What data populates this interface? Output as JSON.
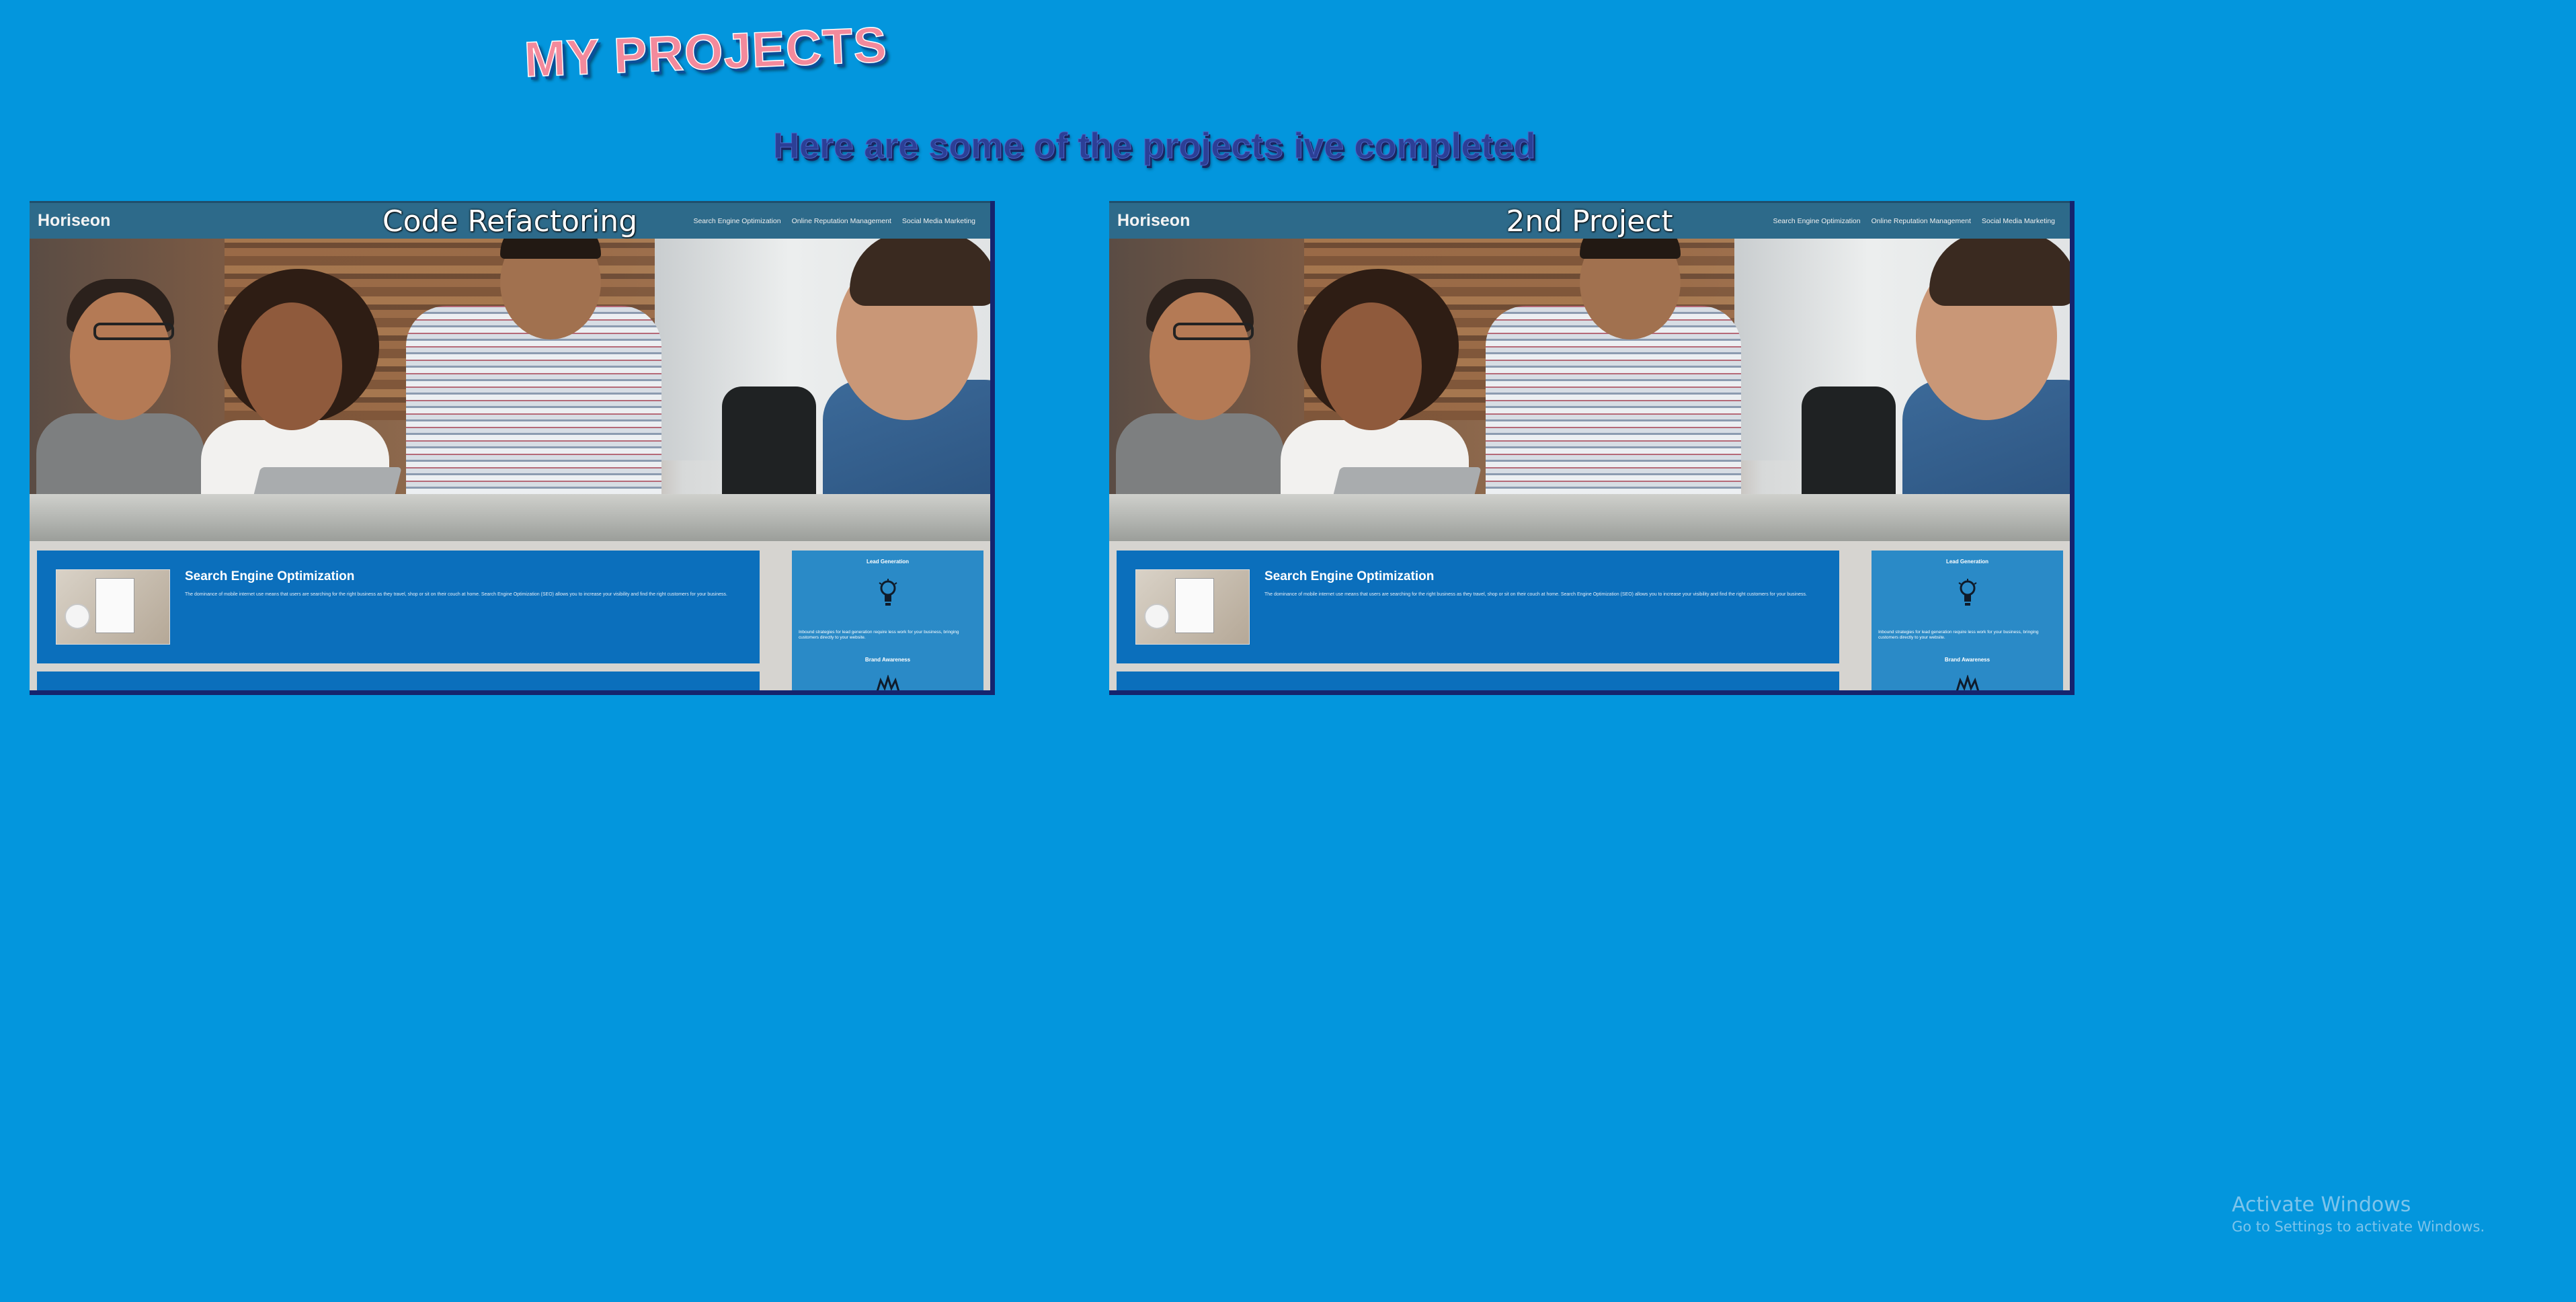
{
  "page": {
    "title": "MY PROJECTS",
    "subtitle": "Here are some of the projects ive completed"
  },
  "projects": [
    {
      "brand": "Horiseon",
      "name": "Code Refactoring",
      "nav": [
        "Search Engine Optimization",
        "Online Reputation Management",
        "Social Media Marketing"
      ],
      "seo_title": "Search Engine Optimization",
      "seo_text": "The dominance of mobile internet use means that users are searching for the right business as they travel, shop or sit on their couch at home. Search Engine Optimization (SEO) allows you to increase your visibility and find the right customers for your business.",
      "side_heading_1": "Lead Generation",
      "side_text": "Inbound strategies for lead generation require less work for your business, bringing customers directly to your website.",
      "side_heading_2": "Brand Awareness"
    },
    {
      "brand": "Horiseon",
      "name": "2nd Project",
      "nav": [
        "Search Engine Optimization",
        "Online Reputation Management",
        "Social Media Marketing"
      ],
      "seo_title": "Search Engine Optimization",
      "seo_text": "The dominance of mobile internet use means that users are searching for the right business as they travel, shop or sit on their couch at home. Search Engine Optimization (SEO) allows you to increase your visibility and find the right customers for your business.",
      "side_heading_1": "Lead Generation",
      "side_text": "Inbound strategies for lead generation require less work for your business, bringing customers directly to your website.",
      "side_heading_2": "Brand Awareness"
    }
  ],
  "watermark": {
    "title": "Activate Windows",
    "subtitle": "Go to Settings to activate Windows."
  },
  "colors": {
    "background": "#0396dd",
    "title": "#f38a9c",
    "subtitle": "#2c3f96",
    "card_border": "#15246e",
    "header": "#2d6a8a",
    "seo_panel": "#0b6fbc",
    "side_panel": "#2a8ac7"
  },
  "icons": {
    "lead_generation": "lightbulb-icon",
    "brand_awareness": "brand-awareness-icon"
  }
}
